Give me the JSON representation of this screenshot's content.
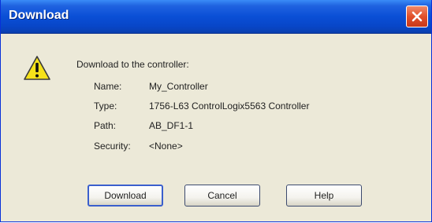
{
  "window": {
    "title": "Download",
    "close_icon": "close-icon",
    "accent": "#0a4fd6",
    "close_color": "#e2512a"
  },
  "dialog": {
    "icon": "warning-icon",
    "heading": "Download to the controller:",
    "fields": [
      {
        "label": "Name:",
        "value": "My_Controller"
      },
      {
        "label": "Type:",
        "value": "1756-L63 ControlLogix5563 Controller"
      },
      {
        "label": "Path:",
        "value": "AB_DF1-1"
      },
      {
        "label": "Security:",
        "value": "<None>"
      }
    ]
  },
  "buttons": {
    "download": "Download",
    "cancel": "Cancel",
    "help": "Help"
  }
}
